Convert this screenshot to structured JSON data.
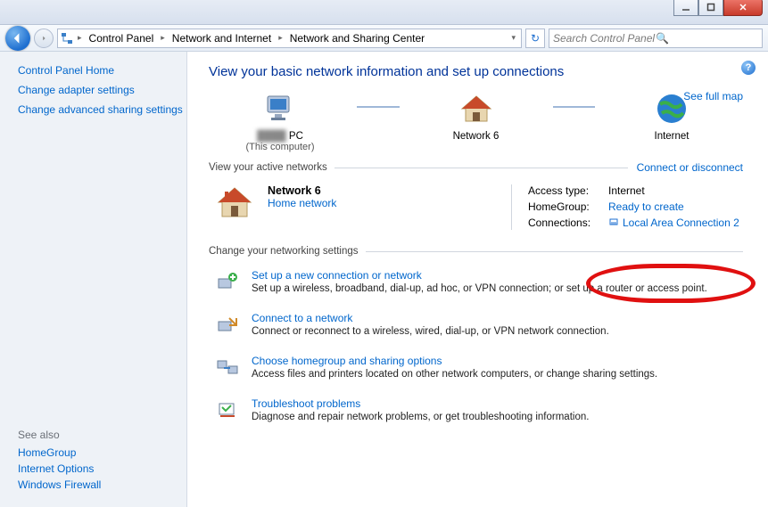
{
  "titlebar": {
    "min": "",
    "max": "",
    "close": ""
  },
  "nav": {
    "crumbs": [
      "Control Panel",
      "Network and Internet",
      "Network and Sharing Center"
    ],
    "search_placeholder": "Search Control Panel"
  },
  "sidebar": {
    "home": "Control Panel Home",
    "links": [
      "Change adapter settings",
      "Change advanced sharing settings"
    ],
    "seealso_title": "See also",
    "seealso": [
      "HomeGroup",
      "Internet Options",
      "Windows Firewall"
    ]
  },
  "content": {
    "heading": "View your basic network information and set up connections",
    "full_map": "See full map",
    "nodes": {
      "pc_suffix": "PC",
      "pc_sub": "(This computer)",
      "network": "Network  6",
      "internet": "Internet"
    },
    "active_title": "View your active networks",
    "connect_link": "Connect or disconnect",
    "active": {
      "name": "Network  6",
      "type": "Home network",
      "access_k": "Access type:",
      "access_v": "Internet",
      "hg_k": "HomeGroup:",
      "hg_v": "Ready to create",
      "conn_k": "Connections:",
      "conn_v": "Local Area Connection 2"
    },
    "settings_title": "Change your networking settings",
    "tasks": [
      {
        "title": "Set up a new connection or network",
        "desc": "Set up a wireless, broadband, dial-up, ad hoc, or VPN connection; or set up a router or access point."
      },
      {
        "title": "Connect to a network",
        "desc": "Connect or reconnect to a wireless, wired, dial-up, or VPN network connection."
      },
      {
        "title": "Choose homegroup and sharing options",
        "desc": "Access files and printers located on other network computers, or change sharing settings."
      },
      {
        "title": "Troubleshoot problems",
        "desc": "Diagnose and repair network problems, or get troubleshooting information."
      }
    ]
  }
}
